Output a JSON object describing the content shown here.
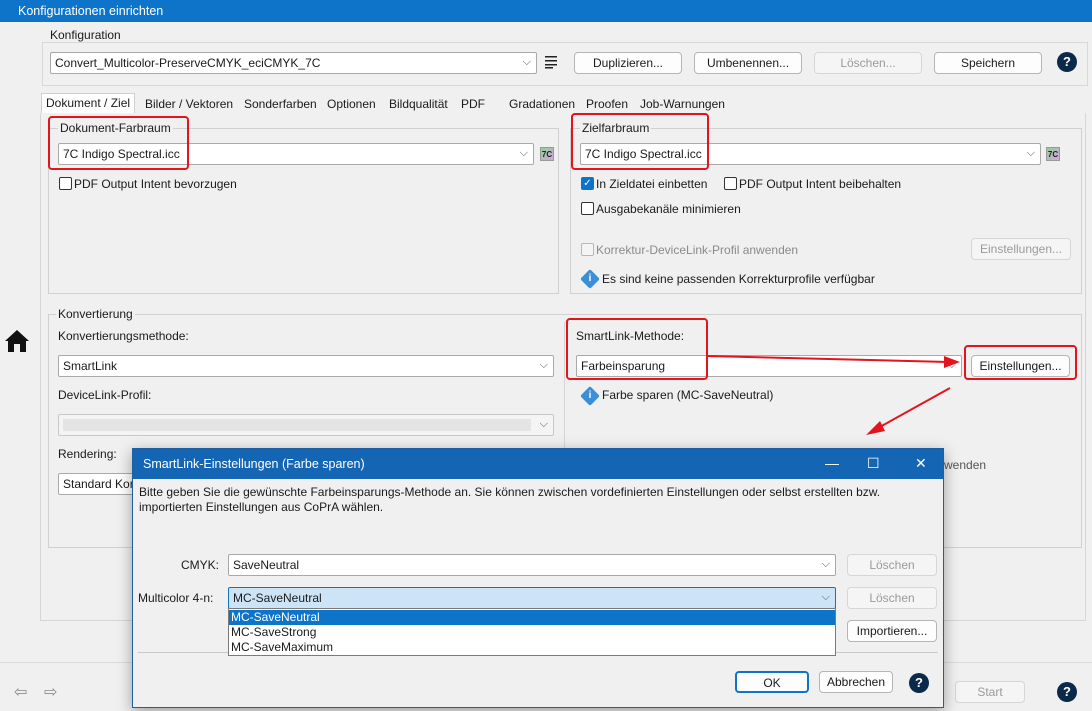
{
  "window": {
    "title": "Konfigurationen einrichten"
  },
  "config": {
    "group_label": "Konfiguration",
    "selected": "Convert_Multicolor-PreserveCMYK_eciCMYK_7C",
    "buttons": {
      "duplicate": "Duplizieren...",
      "rename": "Umbenennen...",
      "delete": "Löschen...",
      "save": "Speichern"
    },
    "help": "?"
  },
  "tabs": [
    {
      "label": "Dokument / Ziel"
    },
    {
      "label": "Bilder / Vektoren"
    },
    {
      "label": "Sonderfarben"
    },
    {
      "label": "Optionen"
    },
    {
      "label": "Bildqualität"
    },
    {
      "label": "PDF"
    },
    {
      "label": "Gradationen"
    },
    {
      "label": "Proofen"
    },
    {
      "label": "Job-Warnungen"
    }
  ],
  "document_space": {
    "label": "Dokument-Farbraum",
    "profile": "7C Indigo Spectral.icc",
    "badge": "7C",
    "pdf_output_intent": {
      "label": "PDF Output Intent bevorzugen",
      "checked": false
    }
  },
  "target_space": {
    "label": "Zielfarbraum",
    "profile": "7C Indigo Spectral.icc",
    "badge": "7C",
    "embed": {
      "label": "In Zieldatei einbetten",
      "checked": true
    },
    "keep_output_intent": {
      "label": "PDF Output Intent beibehalten",
      "checked": false
    },
    "minimize_channels": {
      "label": "Ausgabekanäle minimieren",
      "checked": false
    },
    "correction_devicelink": {
      "label": "Korrektur-DeviceLink-Profil anwenden",
      "checked": false
    },
    "settings_button": "Einstellungen...",
    "info": "Es sind keine passenden Korrekturprofile verfügbar"
  },
  "conversion": {
    "group_label": "Konvertierung",
    "method_label": "Konvertierungsmethode:",
    "method": "SmartLink",
    "devicelink_label": "DeviceLink-Profil:",
    "devicelink": "",
    "rendering_label": "Rendering:",
    "rendering": "Standard Kon",
    "smartlink_label": "SmartLink-Methode:",
    "smartlink_method": "Farbeinsparung",
    "smartlink_settings": "Einstellungen...",
    "smartlink_info": "Farbe sparen (MC-SaveNeutral)",
    "hidden_fragment": "wenden"
  },
  "dialog": {
    "title": "SmartLink-Einstellungen (Farbe sparen)",
    "description": "Bitte geben Sie die gewünschte Farbeinsparungs-Methode an. Sie können zwischen vordefinierten Einstellungen oder selbst erstellten bzw. importierten Einstellungen aus CoPrA wählen.",
    "cmyk_label": "CMYK:",
    "cmyk_value": "SaveNeutral",
    "multicolor_label": "Multicolor 4-n:",
    "multicolor_value": "MC-SaveNeutral",
    "delete_label": "Löschen",
    "import_label": "Importieren...",
    "ok": "OK",
    "cancel": "Abbrechen",
    "help": "?",
    "options": [
      "MC-SaveNeutral",
      "MC-SaveStrong",
      "MC-SaveMaximum"
    ]
  },
  "footer": {
    "start": "Start",
    "help": "?"
  },
  "colors": {
    "accent": "#0e74c9",
    "highlight_box": "#e3141c",
    "title_bar": "#0e74c9"
  }
}
